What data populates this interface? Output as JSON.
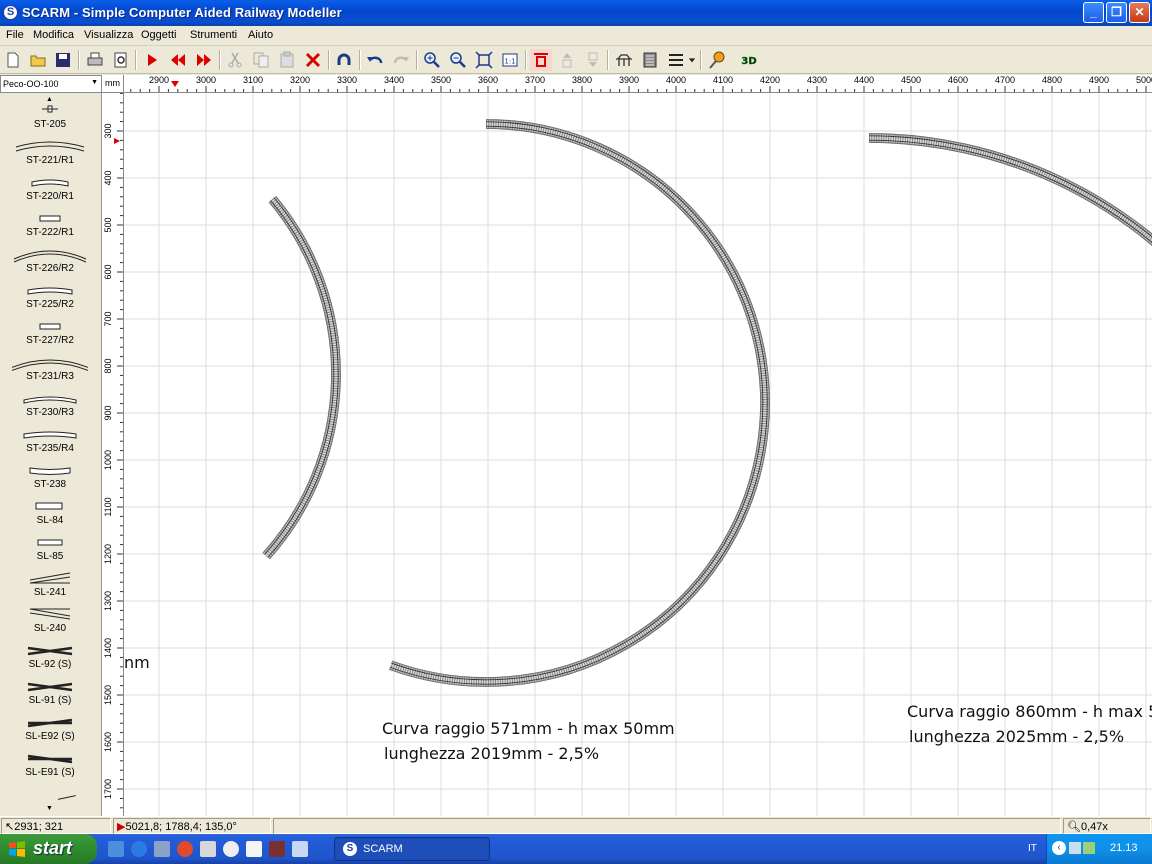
{
  "window": {
    "title": "SCARM - Simple Computer Aided Railway Modeller",
    "app_icon": "S"
  },
  "menu": [
    "File",
    "Modifica",
    "Visualizza",
    "Oggetti",
    "Strumenti",
    "Aiuto"
  ],
  "toolbar": {
    "icons": [
      "new-icon",
      "open-icon",
      "save-icon",
      "print-icon",
      "print-preview-icon",
      "play-icon",
      "rewind-icon",
      "forward-icon",
      "cut-icon",
      "copy-icon",
      "paste-icon",
      "delete-icon",
      "rotate-icon",
      "undo-icon",
      "redo-icon",
      "zoom-in-icon",
      "zoom-out-icon",
      "zoom-fit-icon",
      "zoom-1to1-icon",
      "flex-track-icon",
      "height-up-icon",
      "height-down-icon",
      "bridge-icon",
      "tunnel-icon",
      "layers-icon",
      "measure-icon",
      "view-3d-icon"
    ],
    "zoom_1to1_label": "1:1",
    "view_3d_label": "3D"
  },
  "library": {
    "selected": "Peco-OO-100",
    "unit": "mm",
    "parts": [
      "ST-205",
      "ST-221/R1",
      "ST-220/R1",
      "ST-222/R1",
      "ST-226/R2",
      "ST-225/R2",
      "ST-227/R2",
      "ST-231/R3",
      "ST-230/R3",
      "ST-235/R4",
      "ST-238",
      "SL-84",
      "SL-85",
      "SL-241",
      "SL-240",
      "SL-92 (S)",
      "SL-91 (S)",
      "SL-E92 (S)",
      "SL-E91 (S)"
    ]
  },
  "ruler": {
    "x_labels": [
      "2900",
      "3000",
      "3100",
      "3200",
      "3300",
      "3400",
      "3500",
      "3600",
      "3700",
      "3800",
      "3900",
      "4000",
      "4100",
      "4200",
      "4300",
      "4400",
      "4500",
      "4600",
      "4700",
      "4800",
      "4900",
      "5000"
    ],
    "y_labels": [
      "300",
      "400",
      "500",
      "600",
      "700",
      "800",
      "900",
      "1000",
      "1100",
      "1200",
      "1300",
      "1400",
      "1500",
      "1600",
      "1700"
    ]
  },
  "annotations": {
    "left_fragment": "nm",
    "middle_line1": "Curva raggio 571mm - h max 50mm",
    "middle_line2": "lunghezza 2019mm - 2,5%",
    "right_line1": "Curva raggio 860mm - h max 5",
    "right_line2": "lunghezza 2025mm - 2,5%"
  },
  "statusbar": {
    "cursor": "2931; 321",
    "track_info": "5021,8; 1788,4; 135,0°",
    "zoom": "0,47x"
  },
  "taskbar": {
    "start_label": "start",
    "task_label": "SCARM",
    "language": "IT",
    "clock": "21.13"
  }
}
